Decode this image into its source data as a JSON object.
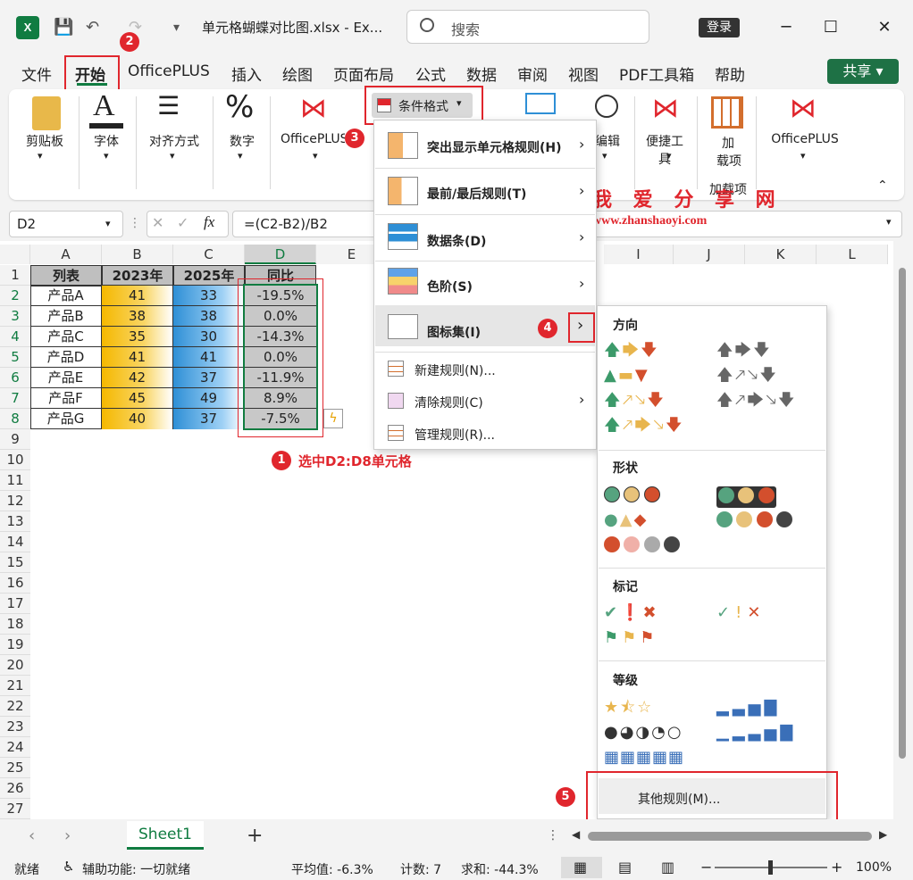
{
  "app": {
    "title": "单元格蝴蝶对比图.xlsx  -  Ex...",
    "search_placeholder": "搜索",
    "login": "登录",
    "share": "共享"
  },
  "tabs": [
    "文件",
    "开始",
    "OfficePLUS",
    "插入",
    "绘图",
    "页面布局",
    "公式",
    "数据",
    "审阅",
    "视图",
    "PDF工具箱",
    "帮助"
  ],
  "ribbon": {
    "clipboard": "剪贴板",
    "font": "字体",
    "align": "对齐方式",
    "number": "数字",
    "officeplus": "OfficePLUS",
    "cond_format": "条件格式",
    "edit": "编辑",
    "tools": "便捷工具",
    "addin_line1": "加",
    "addin_line2": "载项",
    "addin_group": "加载项",
    "officeplus2": "OfficePLUS"
  },
  "formula": {
    "name_box": "D2",
    "fx": "fx",
    "value": "=(C2-B2)/B2"
  },
  "columns": [
    "A",
    "B",
    "C",
    "D",
    "E",
    "",
    "",
    "",
    "I",
    "J",
    "K",
    "L"
  ],
  "rows": [
    "1",
    "2",
    "3",
    "4",
    "5",
    "6",
    "7",
    "8",
    "9",
    "10",
    "11",
    "12",
    "13",
    "14",
    "15",
    "16",
    "17",
    "18",
    "19",
    "20",
    "21",
    "22",
    "23",
    "24",
    "25",
    "26",
    "27"
  ],
  "table": {
    "headers": [
      "列表",
      "2023年",
      "2025年",
      "同比"
    ],
    "data": [
      [
        "产品A",
        "41",
        "33",
        "-19.5%"
      ],
      [
        "产品B",
        "38",
        "38",
        "0.0%"
      ],
      [
        "产品C",
        "35",
        "30",
        "-14.3%"
      ],
      [
        "产品D",
        "41",
        "41",
        "0.0%"
      ],
      [
        "产品E",
        "42",
        "37",
        "-11.9%"
      ],
      [
        "产品F",
        "45",
        "49",
        "8.9%"
      ],
      [
        "产品G",
        "40",
        "37",
        "-7.5%"
      ]
    ]
  },
  "annotations": {
    "b1": "1",
    "b2": "2",
    "b3": "3",
    "b4": "4",
    "b5": "5",
    "step1": "选中D2:D8单元格"
  },
  "cf_menu": {
    "items": [
      "突出显示单元格规则(H)",
      "最前/最后规则(T)",
      "数据条(D)",
      "色阶(S)",
      "图标集(I)"
    ],
    "actions": [
      "新建规则(N)...",
      "清除规则(C)",
      "管理规则(R)..."
    ]
  },
  "icon_menu": {
    "directions": "方向",
    "shapes": "形状",
    "indicators": "标记",
    "ratings": "等级",
    "more": "其他规则(M)..."
  },
  "watermark": {
    "cn": "我 爱 分 享 网",
    "url": "www.zhanshaoyi.com"
  },
  "sheet": {
    "name": "Sheet1",
    "add": "+"
  },
  "status": {
    "ready": "就绪",
    "accessibility": "辅助功能: 一切就绪",
    "average": "平均值: -6.3%",
    "count": "计数: 7",
    "sum": "求和: -44.3%",
    "zoom": "100%"
  },
  "colors": {
    "excel_green": "#107c41",
    "accent_red": "#e0262d",
    "bar_yellow": "#f5b800",
    "bar_blue": "#2e8fd6"
  }
}
